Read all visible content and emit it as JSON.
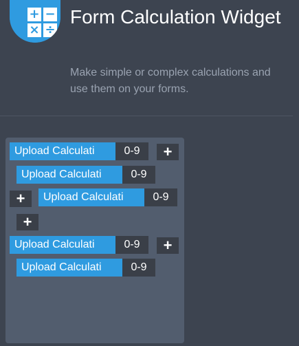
{
  "header": {
    "title": "Form Calculation Widget",
    "subtitle": "Make simple or complex calculations and use them on your forms.",
    "logo_glyphs": [
      "+",
      "−",
      "×",
      "÷"
    ],
    "accent_color": "#2f9be0"
  },
  "builder": {
    "rows": [
      {
        "label": "Upload Calculati",
        "range": "0-9"
      },
      {
        "label": "Upload Calculati",
        "range": "0-9"
      },
      {
        "label": "Upload Calculati",
        "range": "0-9"
      },
      {
        "label": "Upload Calculati",
        "range": "0-9"
      },
      {
        "label": "Upload Calculati",
        "range": "0-9"
      }
    ],
    "add_label": "+"
  }
}
